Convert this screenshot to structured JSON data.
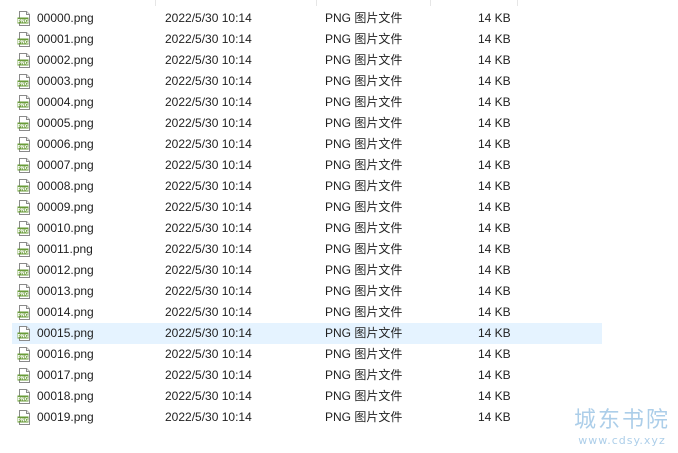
{
  "files": [
    {
      "name": "00000.png",
      "date": "2022/5/30 10:14",
      "type": "PNG 图片文件",
      "size": "14 KB",
      "icon": "png-file-icon"
    },
    {
      "name": "00001.png",
      "date": "2022/5/30 10:14",
      "type": "PNG 图片文件",
      "size": "14 KB",
      "icon": "png-file-icon"
    },
    {
      "name": "00002.png",
      "date": "2022/5/30 10:14",
      "type": "PNG 图片文件",
      "size": "14 KB",
      "icon": "png-file-icon"
    },
    {
      "name": "00003.png",
      "date": "2022/5/30 10:14",
      "type": "PNG 图片文件",
      "size": "14 KB",
      "icon": "png-file-icon"
    },
    {
      "name": "00004.png",
      "date": "2022/5/30 10:14",
      "type": "PNG 图片文件",
      "size": "14 KB",
      "icon": "png-file-icon"
    },
    {
      "name": "00005.png",
      "date": "2022/5/30 10:14",
      "type": "PNG 图片文件",
      "size": "14 KB",
      "icon": "png-file-icon"
    },
    {
      "name": "00006.png",
      "date": "2022/5/30 10:14",
      "type": "PNG 图片文件",
      "size": "14 KB",
      "icon": "png-file-icon"
    },
    {
      "name": "00007.png",
      "date": "2022/5/30 10:14",
      "type": "PNG 图片文件",
      "size": "14 KB",
      "icon": "png-file-icon"
    },
    {
      "name": "00008.png",
      "date": "2022/5/30 10:14",
      "type": "PNG 图片文件",
      "size": "14 KB",
      "icon": "png-file-icon"
    },
    {
      "name": "00009.png",
      "date": "2022/5/30 10:14",
      "type": "PNG 图片文件",
      "size": "14 KB",
      "icon": "png-file-icon"
    },
    {
      "name": "00010.png",
      "date": "2022/5/30 10:14",
      "type": "PNG 图片文件",
      "size": "14 KB",
      "icon": "png-file-icon"
    },
    {
      "name": "00011.png",
      "date": "2022/5/30 10:14",
      "type": "PNG 图片文件",
      "size": "14 KB",
      "icon": "png-file-icon"
    },
    {
      "name": "00012.png",
      "date": "2022/5/30 10:14",
      "type": "PNG 图片文件",
      "size": "14 KB",
      "icon": "png-file-icon"
    },
    {
      "name": "00013.png",
      "date": "2022/5/30 10:14",
      "type": "PNG 图片文件",
      "size": "14 KB",
      "icon": "png-file-icon"
    },
    {
      "name": "00014.png",
      "date": "2022/5/30 10:14",
      "type": "PNG 图片文件",
      "size": "14 KB",
      "icon": "png-file-icon"
    },
    {
      "name": "00015.png",
      "date": "2022/5/30 10:14",
      "type": "PNG 图片文件",
      "size": "14 KB",
      "icon": "png-file-icon",
      "hover": true
    },
    {
      "name": "00016.png",
      "date": "2022/5/30 10:14",
      "type": "PNG 图片文件",
      "size": "14 KB",
      "icon": "png-file-icon"
    },
    {
      "name": "00017.png",
      "date": "2022/5/30 10:14",
      "type": "PNG 图片文件",
      "size": "14 KB",
      "icon": "png-file-icon"
    },
    {
      "name": "00018.png",
      "date": "2022/5/30 10:14",
      "type": "PNG 图片文件",
      "size": "14 KB",
      "icon": "png-file-icon"
    },
    {
      "name": "00019.png",
      "date": "2022/5/30 10:14",
      "type": "PNG 图片文件",
      "size": "14 KB",
      "icon": "png-file-icon"
    }
  ],
  "watermark": {
    "title": "城东书院",
    "url": "www.cdsy.xyz"
  },
  "colors": {
    "hover_row": "#e5f3ff",
    "text": "#1f1f1f",
    "icon_green": "#6a9c3a",
    "watermark": "#6aa7d8"
  }
}
